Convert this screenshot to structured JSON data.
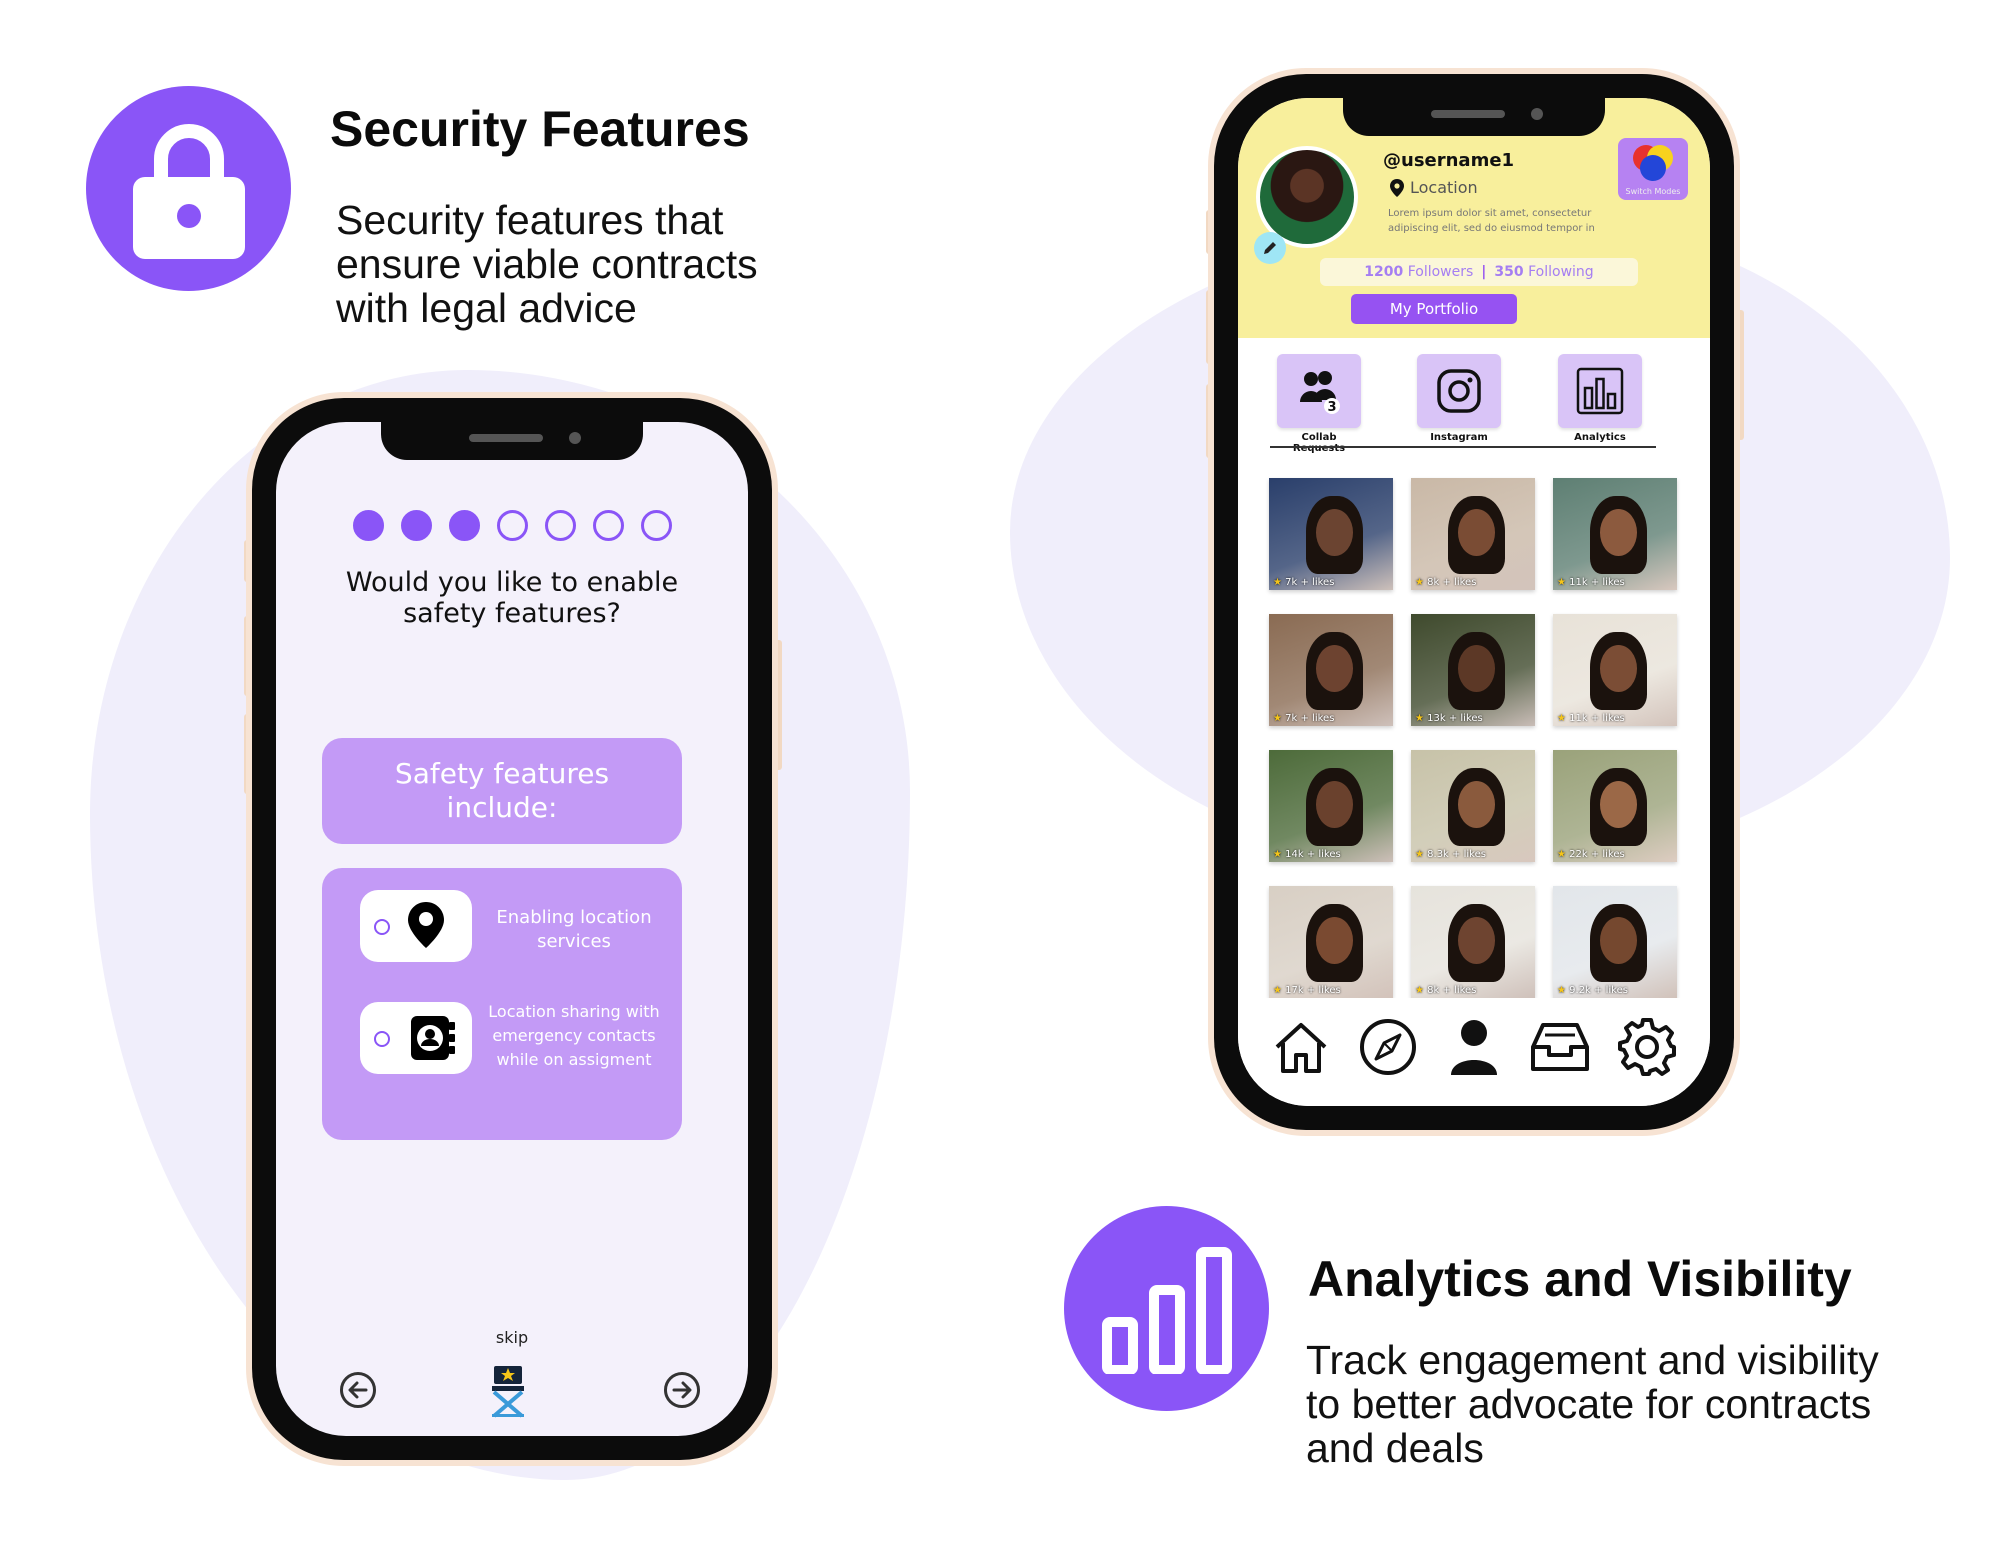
{
  "security": {
    "title": "Security Features",
    "description": "Security features that ensure viable contracts with legal advice",
    "icon": "lock-icon"
  },
  "analytics_feature": {
    "title": "Analytics and Visibility",
    "description": "Track engagement and visibility to better advocate for contracts and deals",
    "icon": "bar-chart-icon"
  },
  "left_phone": {
    "progress": {
      "total_steps": 7,
      "completed_steps": 3
    },
    "question": "Would you like to enable safety features?",
    "safety_header": "Safety features include:",
    "options": [
      {
        "icon": "location-pin-icon",
        "label": "Enabling location services"
      },
      {
        "icon": "contact-book-icon",
        "label": "Location sharing with emergency contacts while on assigment"
      }
    ],
    "skip_label": "skip",
    "back_icon": "arrow-left-icon",
    "next_icon": "arrow-right-icon",
    "center_icon": "director-chair-icon"
  },
  "right_phone": {
    "username": "@username1",
    "location": "Location",
    "bio": "Lorem ipsum dolor sit amet, consectetur adipiscing elit, sed do eiusmod tempor in",
    "switch_modes_label": "Switch Modes",
    "followers_count": "1200",
    "followers_label": "Followers",
    "separator": "|",
    "following_count": "350",
    "following_label": "Following",
    "portfolio_button": "My Portfolio",
    "tabs": [
      {
        "label": "Collab Requests",
        "icon": "people-icon",
        "badge": "3"
      },
      {
        "label": "Instagram",
        "icon": "instagram-icon"
      },
      {
        "label": "Analytics",
        "icon": "bar-chart-icon"
      }
    ],
    "posts": [
      {
        "likes": "7k + likes",
        "bg": "#2a3f6b",
        "face": "#6b4431"
      },
      {
        "likes": "8k + likes",
        "bg": "#c9b8a6",
        "face": "#7a4c34"
      },
      {
        "likes": "11k + likes",
        "bg": "#5e7f73",
        "face": "#8c5a3e"
      },
      {
        "likes": "7k + likes",
        "bg": "#8a6b53",
        "face": "#6d4330"
      },
      {
        "likes": "13k + likes",
        "bg": "#3f4a2d",
        "face": "#5c3826"
      },
      {
        "likes": "11k + likes",
        "bg": "#e8e2d8",
        "face": "#7b4d35"
      },
      {
        "likes": "14k + likes",
        "bg": "#4d6b3a",
        "face": "#6a412d"
      },
      {
        "likes": "8.3k + likes",
        "bg": "#c7c2a8",
        "face": "#8a5a3d"
      },
      {
        "likes": "22k + likes",
        "bg": "#9aa27a",
        "face": "#9b6847"
      },
      {
        "likes": "17k + likes",
        "bg": "#d8cfc4",
        "face": "#7a4a31"
      },
      {
        "likes": "8k + likes",
        "bg": "#e6e3dc",
        "face": "#6e4430"
      },
      {
        "likes": "9.2k + likes",
        "bg": "#e2e6ea",
        "face": "#75482f"
      }
    ],
    "bottom_nav": [
      "home-icon",
      "compass-icon",
      "profile-icon",
      "inbox-icon",
      "settings-icon"
    ]
  },
  "colors": {
    "accent": "#8a55f7",
    "soft_purple": "#c39af6",
    "card_yellow": "#f8ef9c",
    "background_blob": "#f0eefb"
  }
}
